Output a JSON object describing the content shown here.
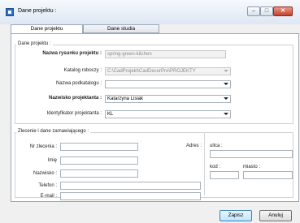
{
  "window": {
    "title": "Dane projektu :"
  },
  "tabs": [
    {
      "label": "Dane projektu"
    },
    {
      "label": "Dane studia"
    }
  ],
  "project_group": {
    "title": "Dane projektu :",
    "name_label": "Nazwa rysunku projektu :",
    "name_value": "spring-green-kitchen",
    "catalog_label": "Katalog roboczy :",
    "catalog_value": "C:\\CadProjekt\\CadDecorPro\\PROJEKTY",
    "subcatalog_label": "Nazwa podkatalogu :",
    "subcatalog_value": "",
    "designer_label": "Nazwisko projektanta :",
    "designer_value": "Katarzyna Lisiak",
    "designer_id_label": "Identyfikator projektanta :",
    "designer_id_value": "KL"
  },
  "order_group": {
    "title": "Zlecenie i dane zamawiającego :",
    "order_no_label": "Nr zlecenia :",
    "first_name_label": "Imię",
    "last_name_label": "Nazwisko :",
    "phone_label": "Telefon :",
    "email_label": "E-mail :",
    "address_label": "Adres :",
    "street_label": "ulica :",
    "postal_label": "kod :",
    "city_label": "miasto :"
  },
  "buttons": {
    "save": "Zapisz",
    "cancel": "Anuluj"
  },
  "window_controls": {
    "minimize": "–",
    "maximize": "□",
    "close": "✕"
  }
}
